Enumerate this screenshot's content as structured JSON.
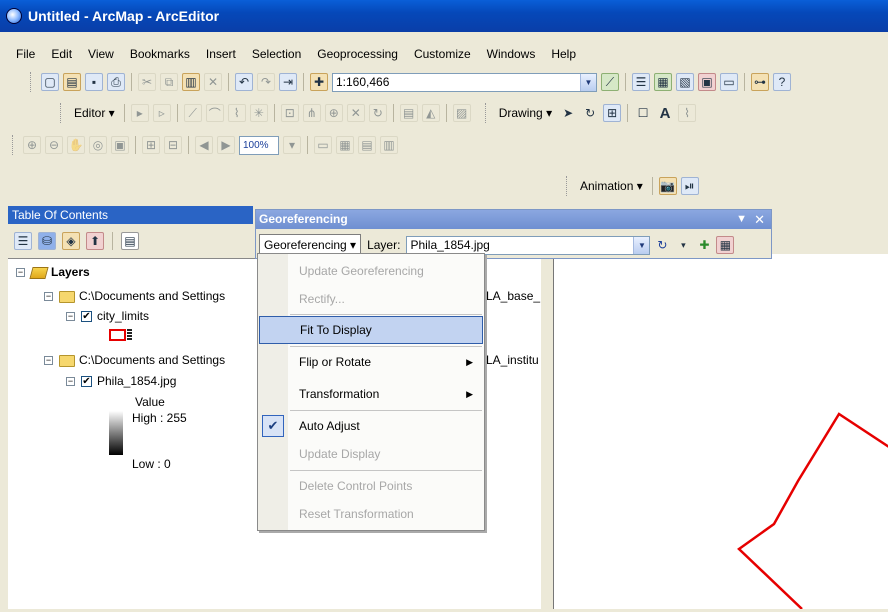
{
  "window": {
    "title": "Untitled - ArcMap - ArcEditor"
  },
  "menubar": [
    "File",
    "Edit",
    "View",
    "Bookmarks",
    "Insert",
    "Selection",
    "Geoprocessing",
    "Customize",
    "Windows",
    "Help"
  ],
  "standard_toolbar": {
    "scale": "1:160,466"
  },
  "editor_toolbar": {
    "editor_label": "Editor ▾",
    "drawing_label": "Drawing ▾"
  },
  "data_frame_toolbar": {
    "zoom": "100%"
  },
  "animation_toolbar": {
    "label": "Animation ▾"
  },
  "toc": {
    "title": "Table Of Contents",
    "root": "Layers",
    "items": [
      {
        "path": "C:\\Documents and Settings",
        "suffix": "LA_base_"
      },
      {
        "layer": "city_limits",
        "checked": true
      },
      {
        "path": "C:\\Documents and Settings",
        "suffix": "LA_institu"
      },
      {
        "layer": "Phila_1854.jpg",
        "checked": true
      }
    ],
    "legend": {
      "value_label": "Value",
      "high": "High : 255",
      "low": "Low : 0"
    }
  },
  "georef": {
    "title": "Georeferencing",
    "menu_label": "Georeferencing ▾",
    "layer_label": "Layer:",
    "layer_value": "Phila_1854.jpg",
    "menu_items": [
      {
        "label": "Update Georeferencing",
        "disabled": true
      },
      {
        "label": "Rectify...",
        "disabled": true
      },
      {
        "label": "Fit To Display",
        "highlighted": true
      },
      {
        "label": "Flip or Rotate",
        "submenu": true
      },
      {
        "label": "Transformation",
        "submenu": true
      },
      {
        "label": "Auto Adjust",
        "checked": true
      },
      {
        "label": "Update Display",
        "disabled": true
      },
      {
        "label": "Delete Control Points",
        "disabled": true
      },
      {
        "label": "Reset Transformation",
        "disabled": true
      }
    ]
  },
  "colors": {
    "titlebar": "#0548b9",
    "highlight": "#c2d3f1",
    "city_limits": "#e60000"
  }
}
